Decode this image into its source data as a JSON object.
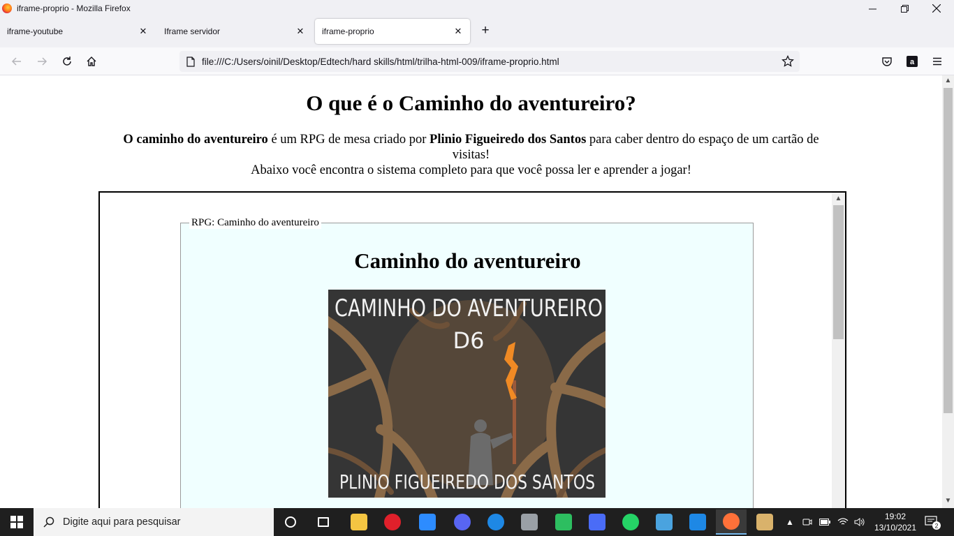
{
  "window": {
    "title": "iframe-proprio - Mozilla Firefox",
    "minimize_glyph": "—",
    "restore_glyph": "❐",
    "close_glyph": "✕"
  },
  "tabs": [
    {
      "label": "iframe-youtube",
      "active": false
    },
    {
      "label": "Iframe servidor",
      "active": false
    },
    {
      "label": "iframe-proprio",
      "active": true
    }
  ],
  "tab_close_glyph": "✕",
  "new_tab_glyph": "+",
  "navbar": {
    "url": "file:///C:/Users/oinil/Desktop/Edtech/hard skills/html/trilha-html-009/iframe-proprio.html",
    "back_enabled": false,
    "forward_enabled": false
  },
  "page": {
    "title": "O que é o Caminho do aventureiro?",
    "intro_bold_1": "O caminho do aventureiro",
    "intro_text_1": " é um RPG de mesa criado por ",
    "intro_bold_2": "Plinio Figueiredo dos Santos",
    "intro_text_2": " para caber dentro do espaço de um cartão de visitas!",
    "intro_line_2": "Abaixo você encontra o sistema completo para que você possa ler e aprender a jogar!"
  },
  "iframe": {
    "legend": "RPG: Caminho do aventureiro",
    "card_title": "Caminho do aventureiro",
    "cover": {
      "title_line_1": "CAMINHO DO AVENTUREIRO",
      "title_line_2": "D6",
      "author": "PLINIO FIGUEIREDO DOS SANTOS",
      "bg_color": "#3a3a3a",
      "accent_color": "#f08a24"
    }
  },
  "taskbar": {
    "search_placeholder": "Digite aqui para pesquisar",
    "time": "19:02",
    "date": "13/10/2021",
    "notification_count": "2",
    "apps": [
      {
        "name": "cortana-icon",
        "color": "#ffffff"
      },
      {
        "name": "task-view-icon",
        "color": "#ffffff"
      },
      {
        "name": "file-explorer-icon",
        "color": "#f4c542"
      },
      {
        "name": "opera-icon",
        "color": "#e0202b"
      },
      {
        "name": "zoom-icon",
        "color": "#2d8cff"
      },
      {
        "name": "discord-icon",
        "color": "#5865f2"
      },
      {
        "name": "edge-legacy-icon",
        "color": "#1e88e5"
      },
      {
        "name": "game-icon",
        "color": "#9aa0a6"
      },
      {
        "name": "evernote-like-icon",
        "color": "#2dbe60"
      },
      {
        "name": "store-icon",
        "color": "#4a6cf7"
      },
      {
        "name": "whatsapp-icon",
        "color": "#25d366"
      },
      {
        "name": "photos-icon",
        "color": "#4aa3df"
      },
      {
        "name": "vscode-icon",
        "color": "#1e88e5"
      },
      {
        "name": "firefox-icon",
        "color": "#ff7139"
      },
      {
        "name": "paint-icon",
        "color": "#d9b26b"
      }
    ]
  }
}
